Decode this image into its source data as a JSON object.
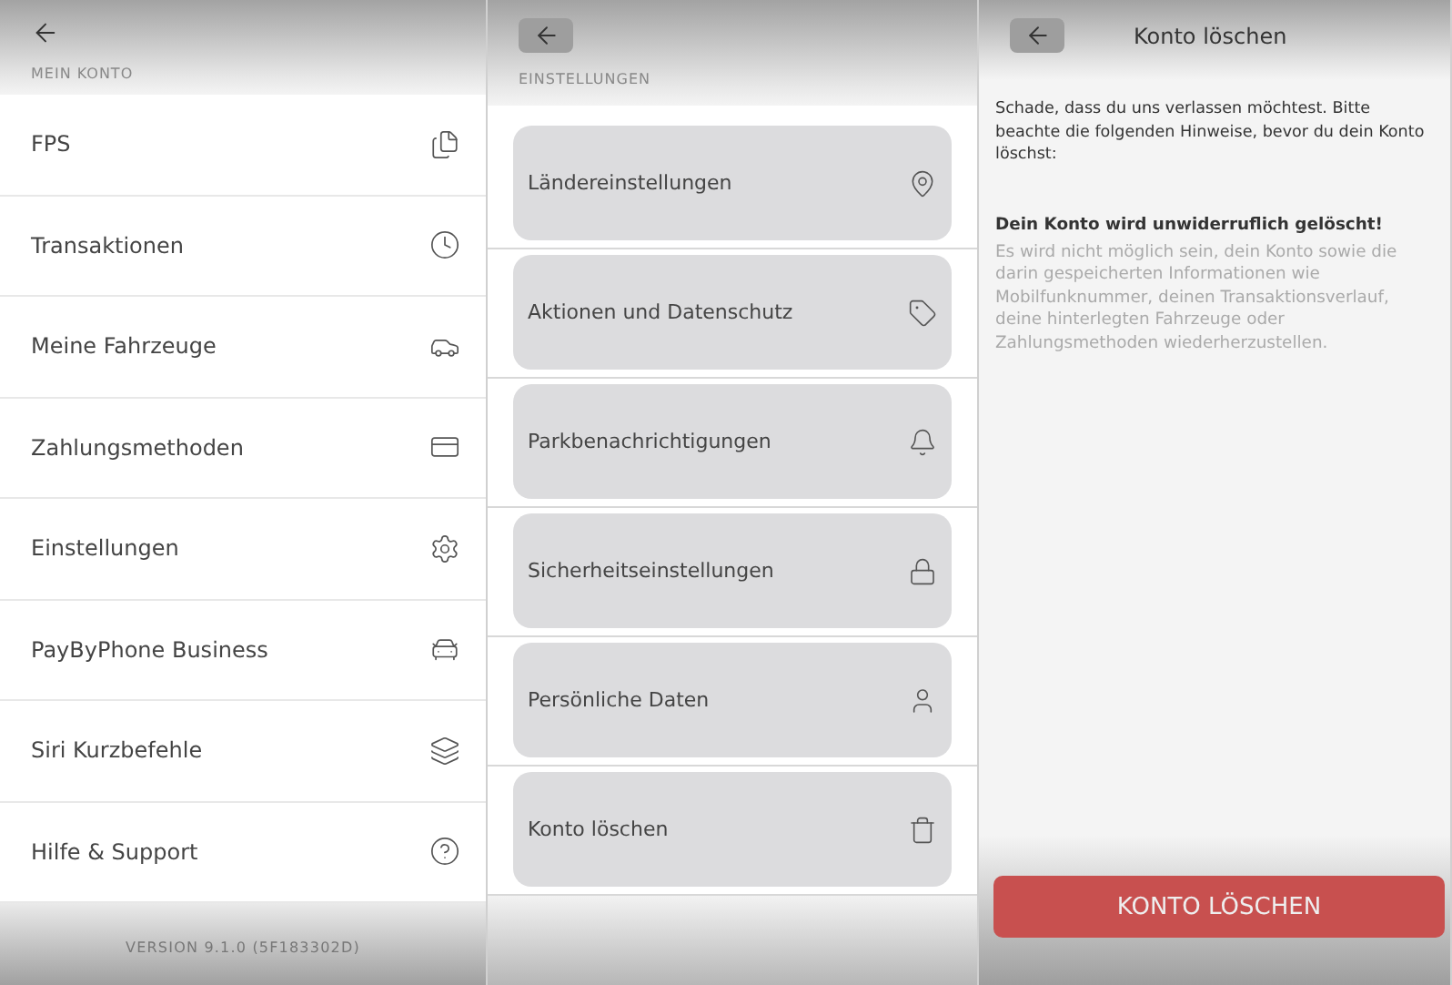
{
  "account_panel": {
    "section_label": "MEIN KONTO",
    "items": [
      {
        "label": "FPS"
      },
      {
        "label": "Transaktionen"
      },
      {
        "label": "Meine Fahrzeuge"
      },
      {
        "label": "Zahlungsmethoden"
      },
      {
        "label": "Einstellungen"
      },
      {
        "label": "PayByPhone Business"
      },
      {
        "label": "Siri Kurzbefehle"
      },
      {
        "label": "Hilfe & Support"
      }
    ],
    "version": "VERSION 9.1.0 (5F183302D)"
  },
  "settings_panel": {
    "section_label": "EINSTELLUNGEN",
    "items": [
      {
        "label": "Ländereinstellungen"
      },
      {
        "label": "Aktionen und Datenschutz"
      },
      {
        "label": "Parkbenachrichtigungen"
      },
      {
        "label": "Sicherheitseinstellungen"
      },
      {
        "label": "Persönliche Daten"
      },
      {
        "label": "Konto löschen"
      }
    ]
  },
  "delete_panel": {
    "title": "Konto löschen",
    "intro": "Schade, dass du uns verlassen möchtest. Bitte beachte die folgenden Hinweise, bevor du dein Konto löschst:",
    "warning": "Dein Konto wird unwiderruflich gelöscht!",
    "details": "Es wird nicht möglich sein, dein Konto sowie die darin gespeicherten Informationen wie Mobilfunknummer, deinen Transaktionsverlauf, deine hinterlegten Fahrzeuge oder Zahlungsmethoden wiederherzustellen.",
    "button": "KONTO LÖSCHEN"
  }
}
